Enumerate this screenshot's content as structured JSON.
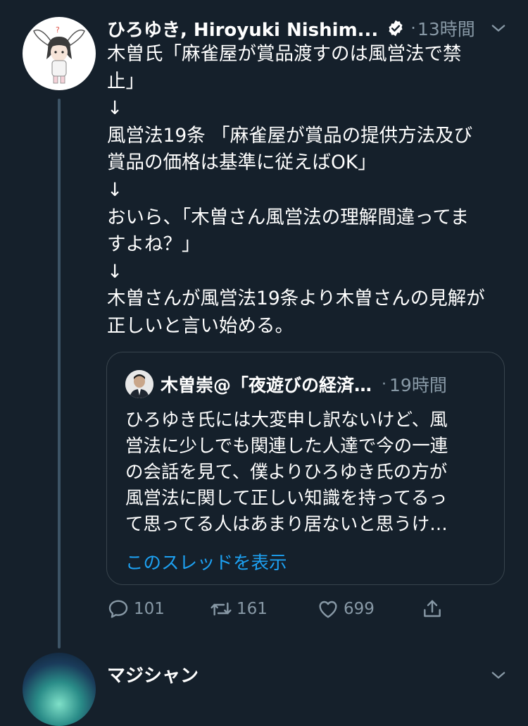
{
  "tweet": {
    "author_name": "ひろゆき, Hiroyuki Nishim...",
    "time": "13時間",
    "dot": "·",
    "lines": [
      "木曽氏「麻雀屋が賞品渡すのは風営法で禁",
      "止」",
      "↓",
      "風営法19条 「麻雀屋が賞品の提供方法及び",
      "賞品の価格は基準に従えばOK」",
      "↓",
      "おいら、「木曽さん風営法の理解間違ってま",
      "すよね？」",
      "↓",
      "木曽さんが風営法19条より木曽さんの見解が",
      "正しいと言い始める。"
    ]
  },
  "quote": {
    "author_name": "木曽崇@「夜遊びの経済…",
    "time": "19時間",
    "dot": "·",
    "lines": [
      "ひろゆき氏には大変申し訳ないけど、風",
      "営法に少しでも関連した人達で今の一連",
      "の会話を見て、僕よりひろゆき氏の方が",
      "風営法に関して正しい知識を持ってるっ",
      "て思ってる人はあまり居ないと思うけ…"
    ],
    "show_thread": "このスレッドを表示"
  },
  "actions": {
    "reply_count": "101",
    "retweet_count": "161",
    "like_count": "699"
  },
  "next_tweet": {
    "author_name": "マジシャン"
  },
  "colors": {
    "background": "#15202b",
    "secondary_text": "#8899a6",
    "link": "#1da1f2",
    "thread_line": "#3d5466"
  },
  "icons": [
    "verified-badge-icon",
    "chevron-down-icon",
    "reply-icon",
    "retweet-icon",
    "like-icon",
    "share-icon"
  ]
}
